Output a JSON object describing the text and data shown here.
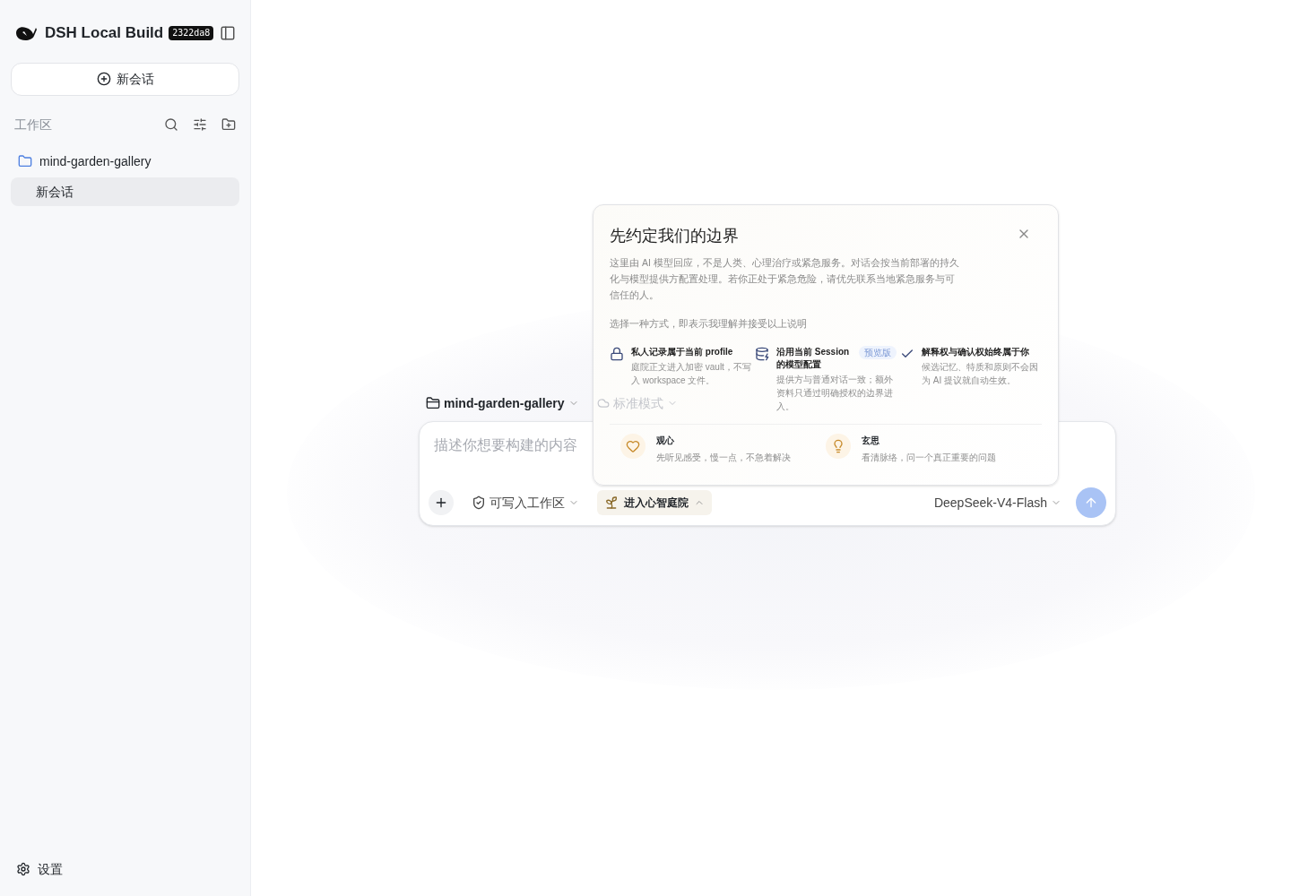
{
  "sidebar": {
    "app_title": "DSH Local Build",
    "build_badge": "2322da8",
    "new_chat_button": "新会话",
    "workspace_label": "工作区",
    "workspaces": [
      {
        "name": "mind-garden-gallery",
        "children": [
          {
            "name": "新会话",
            "selected": true
          }
        ]
      }
    ],
    "settings": "设置"
  },
  "composer": {
    "folder": "mind-garden-gallery",
    "mode": "标准模式",
    "placeholder": "描述你想要构建的内容",
    "permission": "可写入工作区",
    "garden_button": "进入心智庭院",
    "garden_expanded": true,
    "model": "DeepSeek-V4-Flash",
    "send_disabled": true
  },
  "dialog": {
    "title": "先约定我们的边界",
    "body": "这里由 AI 模型回应，不是人类、心理治疗或紧急服务。对话会按当前部署的持久化与模型提供方配置处理。若你正处于紧急危险，请优先联系当地紧急服务与可信任的人。",
    "prompt": "选择一种方式，即表示我理解并接受以上说明",
    "points": [
      {
        "kind": "lock",
        "title": "私人记录属于当前 profile",
        "text": "庭院正文进入加密 vault，不写入 workspace 文件。"
      },
      {
        "kind": "database",
        "title": "沿用当前 Session 的模型配置",
        "badge": "预览版",
        "text": "提供方与普通对话一致；额外资料只通过明确授权的边界进入。"
      },
      {
        "kind": "check",
        "title": "解释权与确认权始终属于你",
        "text": "候选记忆、特质和原则不会因为 AI 提议就自动生效。"
      }
    ],
    "modes": [
      {
        "kind": "heart",
        "title": "观心",
        "text": "先听见感受，慢一点，不急着解决"
      },
      {
        "kind": "bulb",
        "title": "玄思",
        "text": "看清脉络，问一个真正重要的问题"
      }
    ]
  }
}
